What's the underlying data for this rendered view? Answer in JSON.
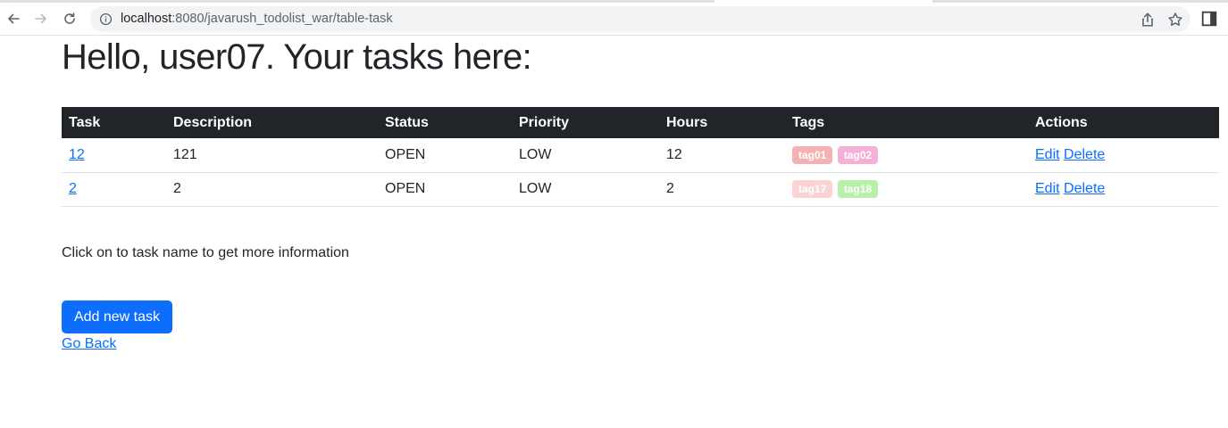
{
  "browser": {
    "url_host": "localhost",
    "url_path": ":8080/javarush_todolist_war/table-task"
  },
  "page": {
    "title": "Hello, user07. Your tasks here:",
    "help_text": "Click on to task name to get more information",
    "add_button_label": "Add new task",
    "go_back_label": "Go Back"
  },
  "table": {
    "headers": [
      "Task",
      "Description",
      "Status",
      "Priority",
      "Hours",
      "Tags",
      "Actions"
    ],
    "rows": [
      {
        "task": "12",
        "description": "121",
        "status": "OPEN",
        "priority": "LOW",
        "hours": "12",
        "tags": [
          {
            "label": "tag01",
            "color": "#f4b2b2"
          },
          {
            "label": "tag02",
            "color": "#f5b0d8"
          }
        ],
        "edit_label": "Edit",
        "delete_label": "Delete"
      },
      {
        "task": "2",
        "description": "2",
        "status": "OPEN",
        "priority": "LOW",
        "hours": "2",
        "tags": [
          {
            "label": "tag17",
            "color": "#fbd3d3"
          },
          {
            "label": "tag18",
            "color": "#b9f0a9"
          }
        ],
        "edit_label": "Edit",
        "delete_label": "Delete"
      }
    ]
  },
  "colors": {
    "header_bg": "#212529",
    "link": "#0d6efd",
    "primary_button": "#0d6efd"
  }
}
